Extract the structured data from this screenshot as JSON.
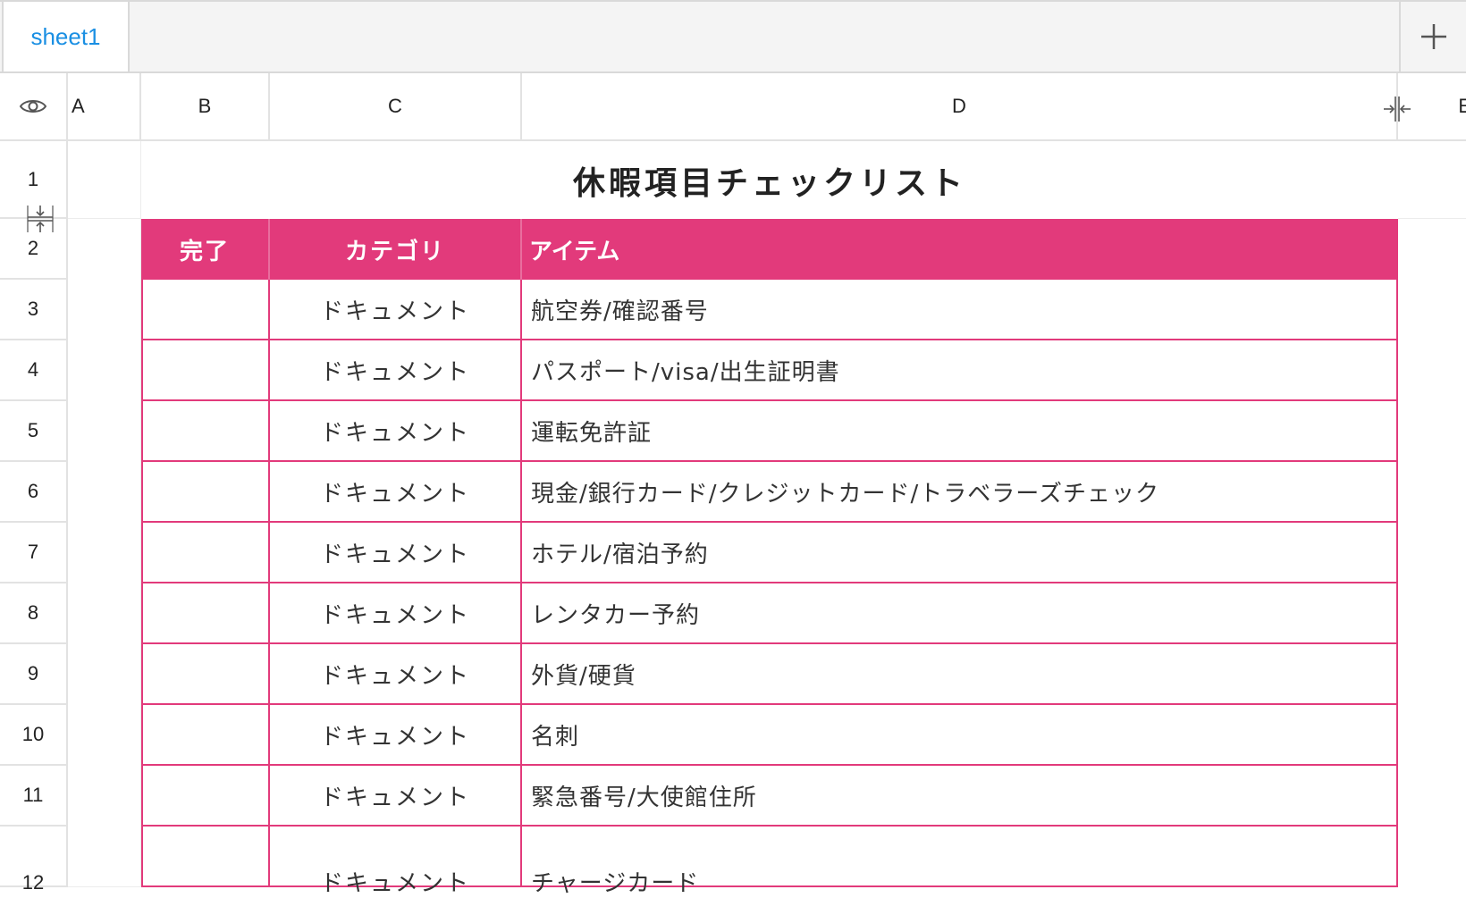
{
  "tabs": [
    {
      "label": "sheet1",
      "active": true
    }
  ],
  "columns": [
    "A",
    "B",
    "C",
    "D",
    "E"
  ],
  "rows": [
    "1",
    "2",
    "3",
    "4",
    "5",
    "6",
    "7",
    "8",
    "9",
    "10",
    "11",
    "12"
  ],
  "title": "休暇項目チェックリスト",
  "header": {
    "done": "完了",
    "category": "カテゴリ",
    "item": "アイテム"
  },
  "items": [
    {
      "category": "ドキュメント",
      "item": "航空券/確認番号"
    },
    {
      "category": "ドキュメント",
      "item": "パスポート/visa/出生証明書"
    },
    {
      "category": "ドキュメント",
      "item": "運転免許証"
    },
    {
      "category": "ドキュメント",
      "item": "現金/銀行カード/クレジットカード/トラベラーズチェック"
    },
    {
      "category": "ドキュメント",
      "item": "ホテル/宿泊予約"
    },
    {
      "category": "ドキュメント",
      "item": "レンタカー予約"
    },
    {
      "category": "ドキュメント",
      "item": "外貨/硬貨"
    },
    {
      "category": "ドキュメント",
      "item": "名刺"
    },
    {
      "category": "ドキュメント",
      "item": "緊急番号/大使館住所"
    },
    {
      "category": "ドキュメント",
      "item": "チャージカード"
    }
  ],
  "colors": {
    "accent": "#e23a7b",
    "tab_text": "#1a8fe3"
  },
  "icons": {
    "add": "plus-icon",
    "visibility": "eye-icon",
    "col_resize": "collapse-columns-icon",
    "row_resize": "collapse-rows-icon"
  }
}
